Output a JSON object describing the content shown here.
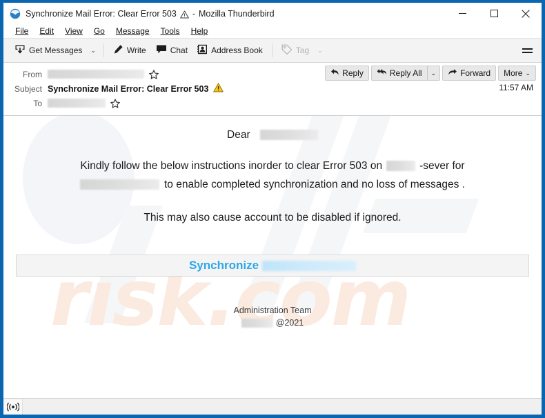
{
  "window": {
    "title": "Synchronize Mail Error: Clear Error 503",
    "app_name": "Mozilla Thunderbird",
    "title_separator": "-",
    "app_icon": "thunderbird-icon",
    "warning_icon": "warning-triangle-icon",
    "controls": {
      "minimize": "minimize-button",
      "maximize": "maximize-button",
      "close": "close-button"
    },
    "frame_color": "#0b66b2"
  },
  "menubar": {
    "items": [
      {
        "label": "File",
        "accel": "F"
      },
      {
        "label": "Edit",
        "accel": "E"
      },
      {
        "label": "View",
        "accel": "V"
      },
      {
        "label": "Go",
        "accel": "G"
      },
      {
        "label": "Message",
        "accel": "M"
      },
      {
        "label": "Tools",
        "accel": "T"
      },
      {
        "label": "Help",
        "accel": "H"
      }
    ]
  },
  "toolbar": {
    "get_messages_label": "Get Messages",
    "get_messages_caret": "⌄",
    "write_label": "Write",
    "chat_label": "Chat",
    "address_book_label": "Address Book",
    "tag_label": "Tag",
    "tag_caret": "⌄",
    "tag_disabled": true,
    "app_menu": "hamburger-menu-icon"
  },
  "message_header": {
    "from_label": "From",
    "from_value_redacted": true,
    "subject_label": "Subject",
    "subject_value": "Synchronize Mail Error: Clear Error 503",
    "subject_warning_icon": "warning-triangle-yellow-icon",
    "to_label": "To",
    "to_value_redacted": true,
    "time": "11:57 AM",
    "actions": {
      "reply": "Reply",
      "reply_all": "Reply All",
      "reply_all_caret": "⌄",
      "forward": "Forward",
      "more": "More",
      "more_caret": "⌄"
    }
  },
  "message_body": {
    "greeting": "Dear",
    "greeting_redacted": true,
    "paragraph_part1": "Kindly follow the below instructions inorder to clear Error 503 on",
    "paragraph_part2": "-sever for",
    "paragraph_part3": "to enable completed synchronization and no loss of messages .",
    "warning_line": "This may also cause account to be disabled if ignored.",
    "cta_label": "Synchronize",
    "cta_redacted": true,
    "cta_color": "#2ca8e8",
    "signature_line1": "Administration Team",
    "signature_line2": "@2021",
    "watermark_text": "risk.com"
  },
  "statusbar": {
    "icon": "broadcast-icon",
    "text": ""
  }
}
